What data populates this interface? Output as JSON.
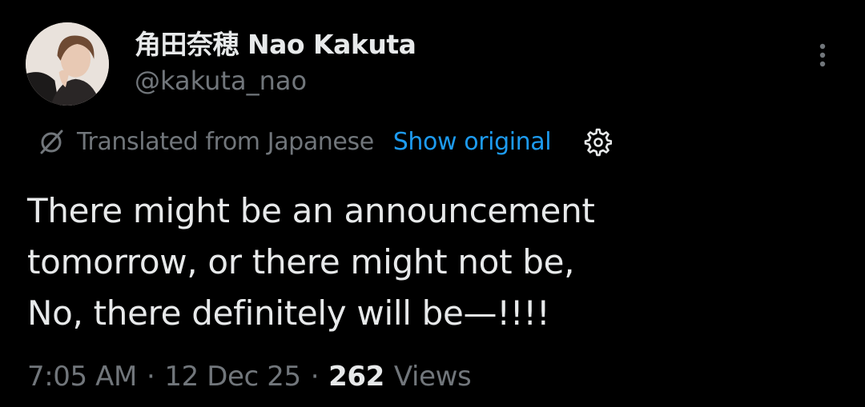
{
  "author": {
    "display_name": "角田奈穂 Nao Kakuta",
    "handle": "@kakuta_nao",
    "avatar_icon": "profile-photo"
  },
  "menu": {
    "icon": "more-vertical-icon"
  },
  "translation": {
    "icon": "translate-slash-icon",
    "label": "Translated from Japanese",
    "show_original_label": "Show original",
    "settings_icon": "gear-icon",
    "link_color": "#1d9bf0"
  },
  "tweet": {
    "lines": [
      "There might be an announcement",
      "tomorrow, or there might not be,",
      "No, there definitely will be—!!!!"
    ]
  },
  "meta": {
    "time": "7:05 AM",
    "separator": "·",
    "date": "12 Dec 25",
    "views_count": "262",
    "views_label": "Views"
  },
  "colors": {
    "background": "#000000",
    "primary_text": "#e7e9ea",
    "secondary_text": "#71767b",
    "accent": "#1d9bf0"
  }
}
